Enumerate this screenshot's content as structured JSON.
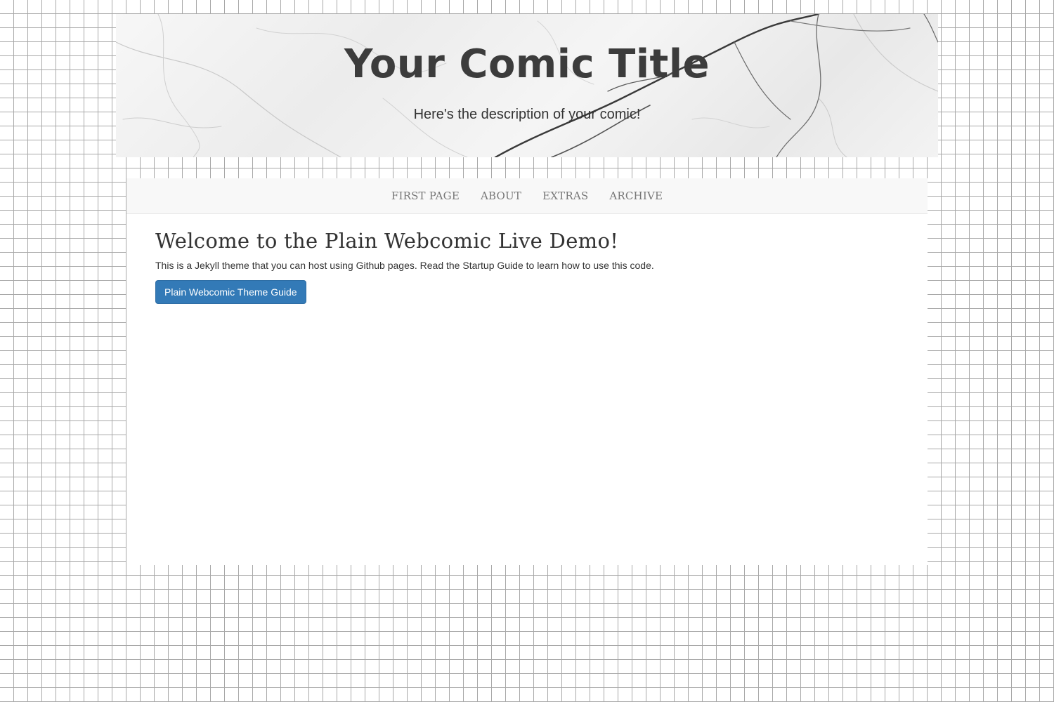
{
  "header": {
    "title": "Your Comic Title",
    "description": "Here's the description of your comic!"
  },
  "nav": {
    "items": [
      {
        "label": "FIRST PAGE"
      },
      {
        "label": "ABOUT"
      },
      {
        "label": "EXTRAS"
      },
      {
        "label": "ARCHIVE"
      }
    ]
  },
  "main": {
    "heading": "Welcome to the Plain Webcomic Live Demo!",
    "intro": "This is a Jekyll theme that you can host using Github pages. Read the Startup Guide to learn how to use this code.",
    "button_label": "Plain Webcomic Theme Guide"
  },
  "colors": {
    "button": "#337ab7",
    "navbar_bg": "#f8f8f8",
    "nav_text": "#777777",
    "title_text": "#3c3c3c"
  }
}
